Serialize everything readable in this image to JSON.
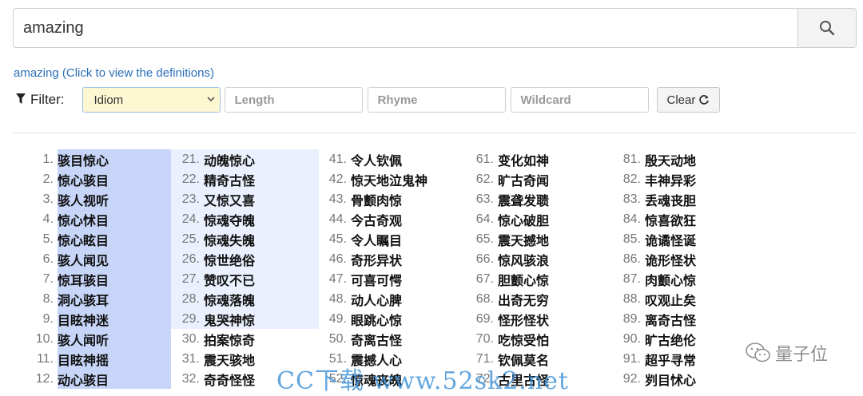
{
  "search": {
    "value": "amazing"
  },
  "definition_link": "amazing (Click to view the definitions)",
  "filter": {
    "label": "Filter:",
    "type_selected": "Idiom",
    "length_placeholder": "Length",
    "rhyme_placeholder": "Rhyme",
    "wildcard_placeholder": "Wildcard",
    "clear_label": "Clear"
  },
  "results": [
    [
      {
        "n": "1.",
        "w": "骇目惊心"
      },
      {
        "n": "2.",
        "w": "惊心骇目"
      },
      {
        "n": "3.",
        "w": "骇人视听"
      },
      {
        "n": "4.",
        "w": "惊心怵目"
      },
      {
        "n": "5.",
        "w": "惊心眩目"
      },
      {
        "n": "6.",
        "w": "骇人闻见"
      },
      {
        "n": "7.",
        "w": "惊耳骇目"
      },
      {
        "n": "8.",
        "w": "洞心骇耳"
      },
      {
        "n": "9.",
        "w": "目眩神迷"
      },
      {
        "n": "10.",
        "w": "骇人闻听"
      },
      {
        "n": "11.",
        "w": "目眩神摇"
      },
      {
        "n": "12.",
        "w": "动心骇目"
      }
    ],
    [
      {
        "n": "21.",
        "w": "动魄惊心"
      },
      {
        "n": "22.",
        "w": "精奇古怪"
      },
      {
        "n": "23.",
        "w": "又惊又喜"
      },
      {
        "n": "24.",
        "w": "惊魂夺魄"
      },
      {
        "n": "25.",
        "w": "惊魂失魄"
      },
      {
        "n": "26.",
        "w": "惊世绝俗"
      },
      {
        "n": "27.",
        "w": "赞叹不已"
      },
      {
        "n": "28.",
        "w": "惊魂落魄"
      },
      {
        "n": "29.",
        "w": "鬼哭神惊"
      },
      {
        "n": "30.",
        "w": "拍案惊奇"
      },
      {
        "n": "31.",
        "w": "震天骇地"
      },
      {
        "n": "32.",
        "w": "奇奇怪怪"
      }
    ],
    [
      {
        "n": "41.",
        "w": "令人钦佩"
      },
      {
        "n": "42.",
        "w": "惊天地泣鬼神"
      },
      {
        "n": "43.",
        "w": "骨颤肉惊"
      },
      {
        "n": "44.",
        "w": "今古奇观"
      },
      {
        "n": "45.",
        "w": "令人瞩目"
      },
      {
        "n": "46.",
        "w": "奇形异状"
      },
      {
        "n": "47.",
        "w": "可喜可愕"
      },
      {
        "n": "48.",
        "w": "动人心脾"
      },
      {
        "n": "49.",
        "w": "眼跳心惊"
      },
      {
        "n": "50.",
        "w": "奇离古怪"
      },
      {
        "n": "51.",
        "w": "震撼人心"
      },
      {
        "n": "52.",
        "w": "惊魂丧魄"
      }
    ],
    [
      {
        "n": "61.",
        "w": "变化如神"
      },
      {
        "n": "62.",
        "w": "旷古奇闻"
      },
      {
        "n": "63.",
        "w": "震聋发聩"
      },
      {
        "n": "64.",
        "w": "惊心破胆"
      },
      {
        "n": "65.",
        "w": "震天撼地"
      },
      {
        "n": "66.",
        "w": "惊风骇浪"
      },
      {
        "n": "67.",
        "w": "胆颤心惊"
      },
      {
        "n": "68.",
        "w": "出奇无穷"
      },
      {
        "n": "69.",
        "w": "怪形怪状"
      },
      {
        "n": "70.",
        "w": "吃惊受怕"
      },
      {
        "n": "71.",
        "w": "钦佩莫名"
      },
      {
        "n": "72.",
        "w": "古里古怪"
      }
    ],
    [
      {
        "n": "81.",
        "w": "殷天动地"
      },
      {
        "n": "82.",
        "w": "丰神异彩"
      },
      {
        "n": "83.",
        "w": "丢魂丧胆"
      },
      {
        "n": "84.",
        "w": "惊喜欲狂"
      },
      {
        "n": "85.",
        "w": "诡谲怪诞"
      },
      {
        "n": "86.",
        "w": "诡形怪状"
      },
      {
        "n": "87.",
        "w": "肉颤心惊"
      },
      {
        "n": "88.",
        "w": "叹观止矣"
      },
      {
        "n": "89.",
        "w": "离奇古怪"
      },
      {
        "n": "90.",
        "w": "旷古绝伦"
      },
      {
        "n": "91.",
        "w": "超乎寻常"
      },
      {
        "n": "92.",
        "w": "刿目怵心"
      }
    ]
  ],
  "watermark_cc": "CC下载 www.52sk2.net",
  "watermark_brand": "量子位"
}
